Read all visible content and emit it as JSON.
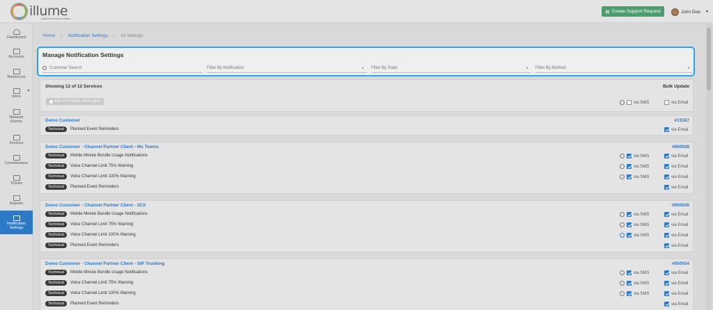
{
  "app": {
    "logo_text": "illume",
    "logo_tagline": "optimum business software"
  },
  "header": {
    "support_label": "Create Support Request",
    "user_name": "John Doe"
  },
  "sidebar": {
    "items": [
      {
        "label": "Dashboard"
      },
      {
        "label": "Accounts"
      },
      {
        "label": "Resources"
      },
      {
        "label": "Voice"
      },
      {
        "label": "Network Events"
      },
      {
        "label": "Invoices"
      },
      {
        "label": "Commissions"
      },
      {
        "label": "Tickets"
      },
      {
        "label": "Reports"
      },
      {
        "label": "Notification Settings"
      }
    ]
  },
  "breadcrumb": {
    "home": "Home",
    "notification_settings": "Notification Settings",
    "current": "All Settings"
  },
  "filters": {
    "title": "Manage Notification Settings",
    "search_placeholder": "Customer Search",
    "by_notification": "Filter By Notification",
    "by_state": "Filter By State",
    "by_method": "Filter By Method"
  },
  "summary": {
    "showing": "Showing 12 of 12 Services",
    "bulk_update": "Bulk Update",
    "no_filters": "NO FILTERS APPLIED",
    "via_sms": "via SMS",
    "via_email": "via Email"
  },
  "services": [
    {
      "name": "Demo Customer",
      "id": "#11587",
      "rows": [
        {
          "tag": "Technical",
          "label": "Planned Event Reminders",
          "sms": "",
          "email": "via Email"
        }
      ]
    },
    {
      "name": "Demo Customer - Channel Partner Client - Ms Teams",
      "id": "#950938",
      "rows": [
        {
          "tag": "Technical",
          "label": "Mobile Minute Bundle Usage Notifications",
          "sms": "via SMS",
          "email": "via Email"
        },
        {
          "tag": "Technical",
          "label": "Voice Channel Limit 75% Warning",
          "sms": "via SMS",
          "email": "via Email"
        },
        {
          "tag": "Technical",
          "label": "Voice Channel Limit 100% Warning",
          "sms": "via SMS",
          "email": "via Email"
        },
        {
          "tag": "Technical",
          "label": "Planned Event Reminders",
          "sms": "",
          "email": "via Email"
        }
      ]
    },
    {
      "name": "Demo Customer - Channel Partner Client - 3CX",
      "id": "#950936",
      "rows": [
        {
          "tag": "Technical",
          "label": "Mobile Minute Bundle Usage Notifications",
          "sms": "via SMS",
          "email": "via Email"
        },
        {
          "tag": "Technical",
          "label": "Voice Channel Limit 75% Warning",
          "sms": "via SMS",
          "email": "via Email"
        },
        {
          "tag": "Technical",
          "label": "Voice Channel Limit 100% Warning",
          "sms": "via SMS",
          "email": "via Email"
        },
        {
          "tag": "Technical",
          "label": "Planned Event Reminders",
          "sms": "",
          "email": "via Email"
        }
      ]
    },
    {
      "name": "Demo Customer - Channel Partner Client - SIP Trunking",
      "id": "#950934",
      "rows": [
        {
          "tag": "Technical",
          "label": "Mobile Minute Bundle Usage Notifications",
          "sms": "via SMS",
          "email": "via Email"
        },
        {
          "tag": "Technical",
          "label": "Voice Channel Limit 75% Warning",
          "sms": "via SMS",
          "email": "via Email"
        },
        {
          "tag": "Technical",
          "label": "Voice Channel Limit 100% Warning",
          "sms": "via SMS",
          "email": "via Email"
        },
        {
          "tag": "Technical",
          "label": "Planned Event Reminders",
          "sms": "",
          "email": "via Email"
        }
      ]
    }
  ]
}
